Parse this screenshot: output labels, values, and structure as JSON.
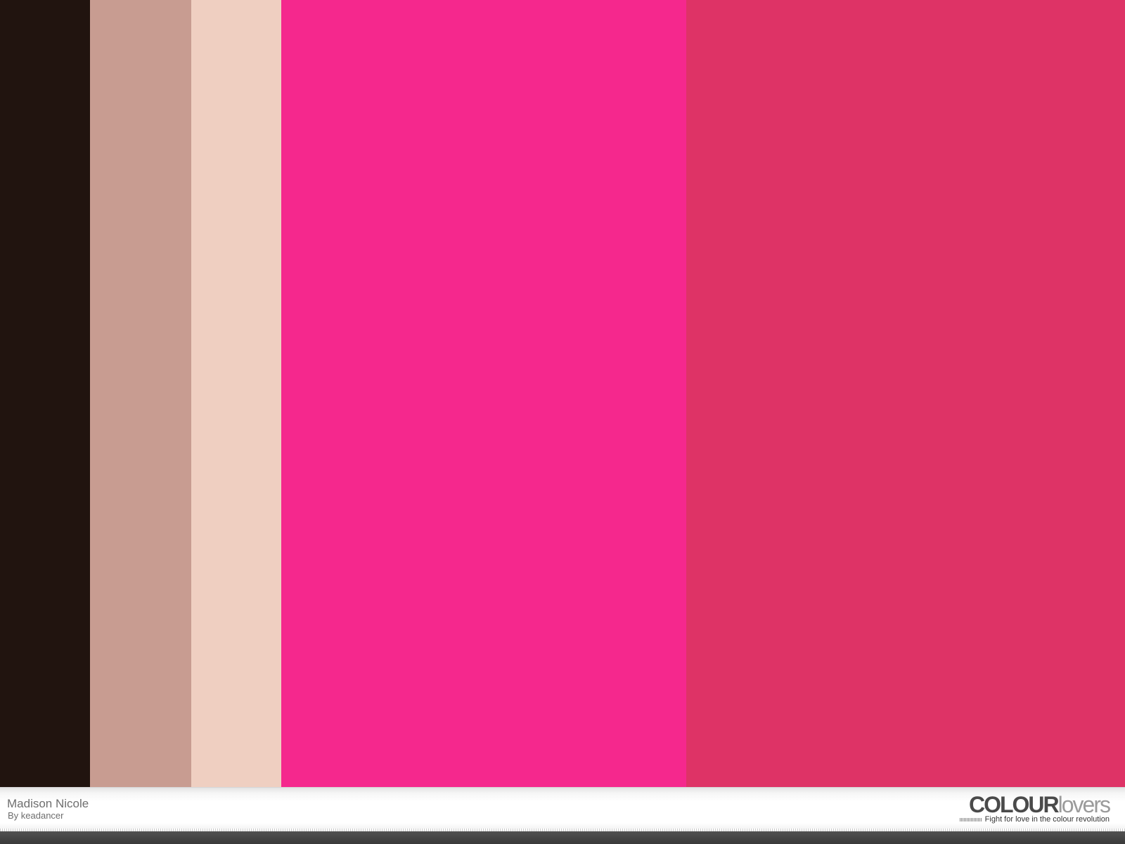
{
  "palette": {
    "title": "Madison Nicole",
    "author": "By keadancer",
    "swatches": [
      {
        "color": "#21140F",
        "share": 0.08
      },
      {
        "color": "#C89C91",
        "share": 0.09
      },
      {
        "color": "#EFCFC1",
        "share": 0.08
      },
      {
        "color": "#F5288D",
        "share": 0.36
      },
      {
        "color": "#DE3366",
        "share": 0.39
      }
    ]
  },
  "logo": {
    "strong": "COLOUR",
    "light": "lovers",
    "tagline": "Fight for love in the colour revolution"
  }
}
